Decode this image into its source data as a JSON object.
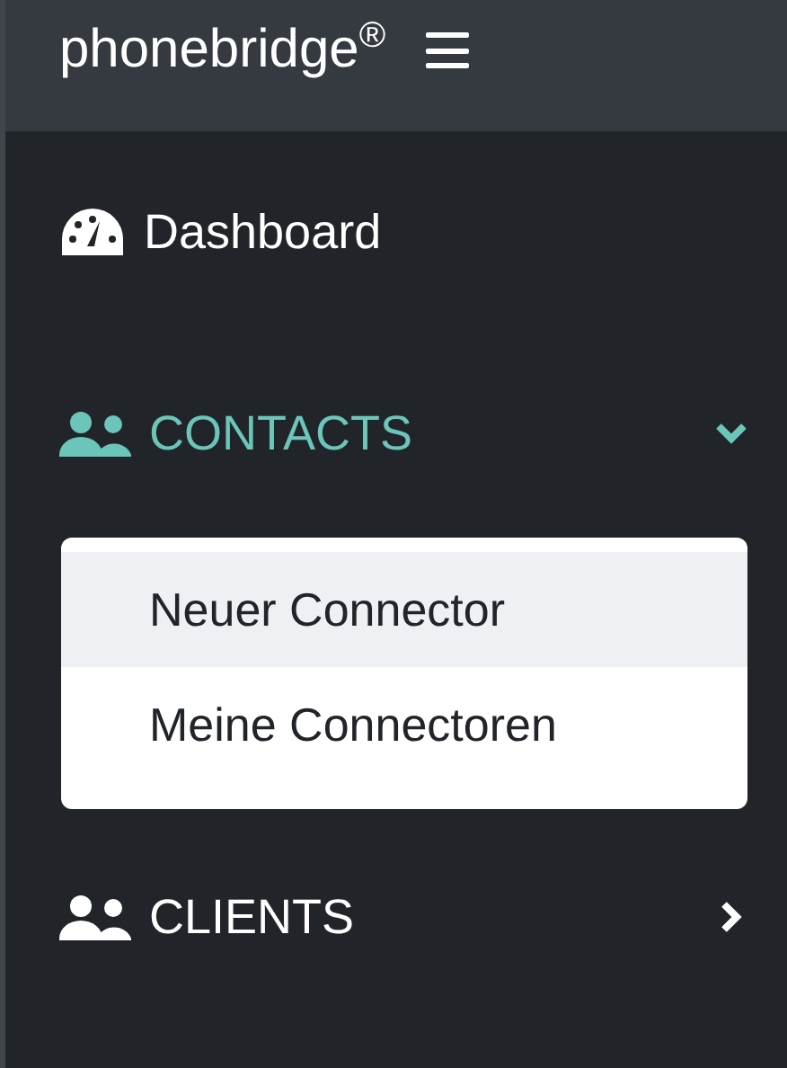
{
  "header": {
    "brand": "phonebridge$^{®}$"
  },
  "nav": [
    {
      "label": "Dashboard",
      "kind": "link",
      "active": false
    },
    {
      "label": "CONTACTS",
      "kind": "group",
      "active": true,
      "expanded": true,
      "children": [
        {
          "label": "Neuer Connector",
          "selected": true
        },
        {
          "label": "Meine Connectoren",
          "selected": false
        }
      ]
    },
    {
      "label": "CLIENTS",
      "kind": "group",
      "active": false,
      "expanded": false
    }
  ]
}
